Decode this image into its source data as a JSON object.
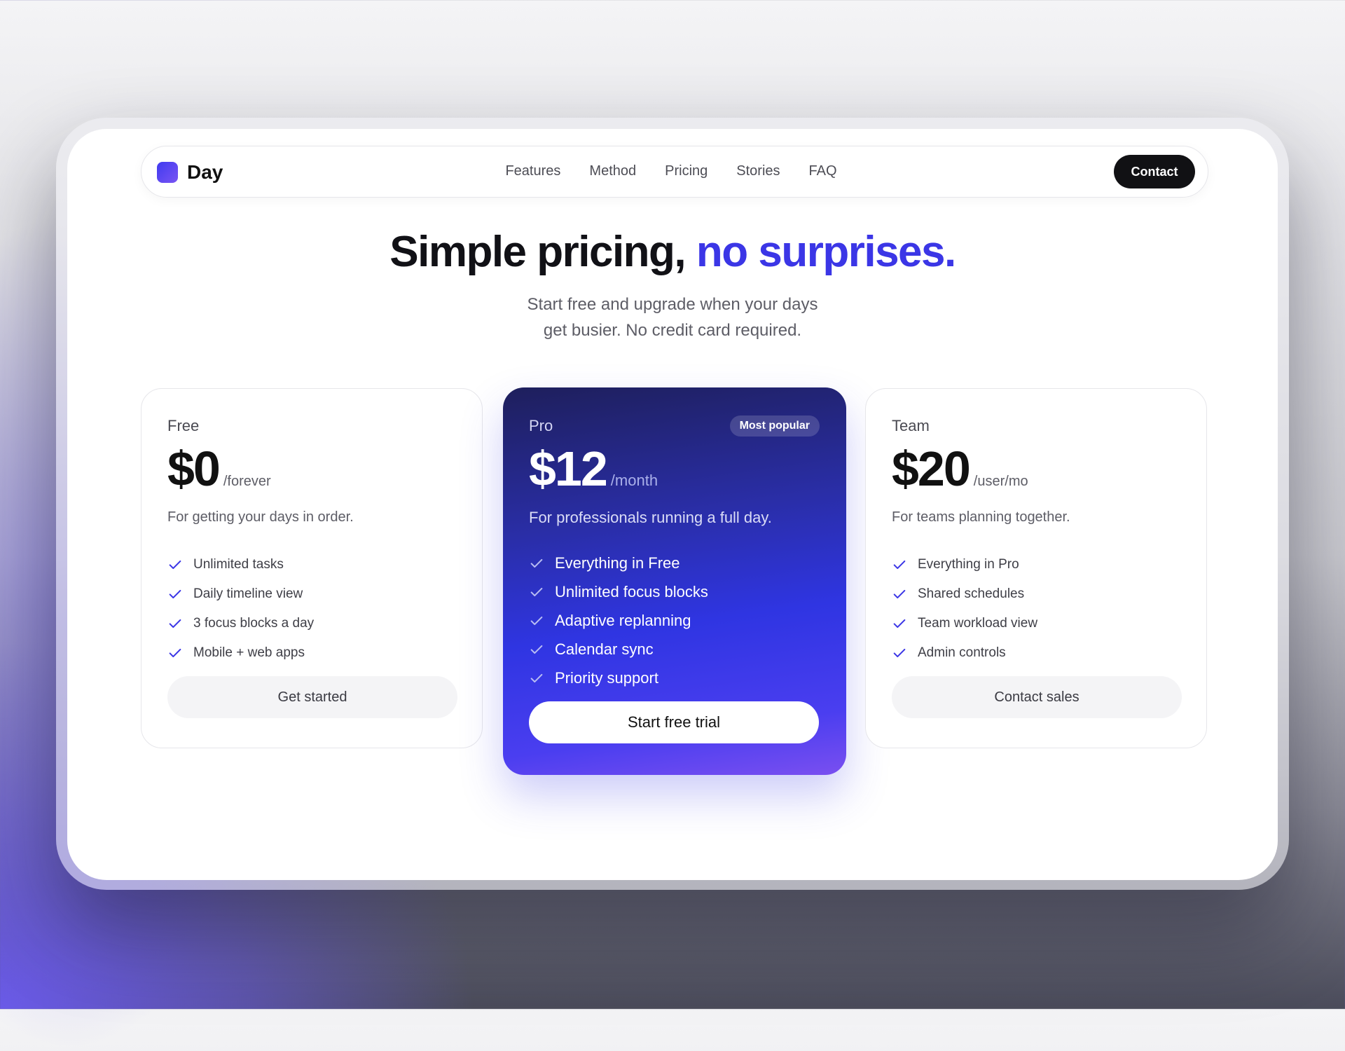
{
  "brand": {
    "name": "Day",
    "accent_color": "#3b36e6"
  },
  "nav": {
    "links": [
      "Features",
      "Method",
      "Pricing",
      "Stories",
      "FAQ"
    ],
    "contact_label": "Contact"
  },
  "hero": {
    "title_main": "Simple pricing,",
    "title_accent": "no surprises.",
    "subtitle_line1": "Start free and upgrade when your days",
    "subtitle_line2": "get busier. No credit card required."
  },
  "plans": [
    {
      "name": "Free",
      "price": "$0",
      "period": "/forever",
      "description": "For getting your days in order.",
      "features": [
        "Unlimited tasks",
        "Daily timeline view",
        "3 focus blocks a day",
        "Mobile + web apps"
      ],
      "cta": "Get started"
    },
    {
      "name": "Pro",
      "badge": "Most popular",
      "price": "$12",
      "period": "/month",
      "description": "For professionals running a full day.",
      "features": [
        "Everything in Free",
        "Unlimited focus blocks",
        "Adaptive replanning",
        "Calendar sync",
        "Priority support"
      ],
      "cta": "Start free trial"
    },
    {
      "name": "Team",
      "price": "$20",
      "period": "/user/mo",
      "description": "For teams planning together.",
      "features": [
        "Everything in Pro",
        "Shared schedules",
        "Team workload view",
        "Admin controls"
      ],
      "cta": "Contact sales"
    }
  ],
  "icons": {
    "check": "check-icon",
    "logo": "logo-mark"
  }
}
